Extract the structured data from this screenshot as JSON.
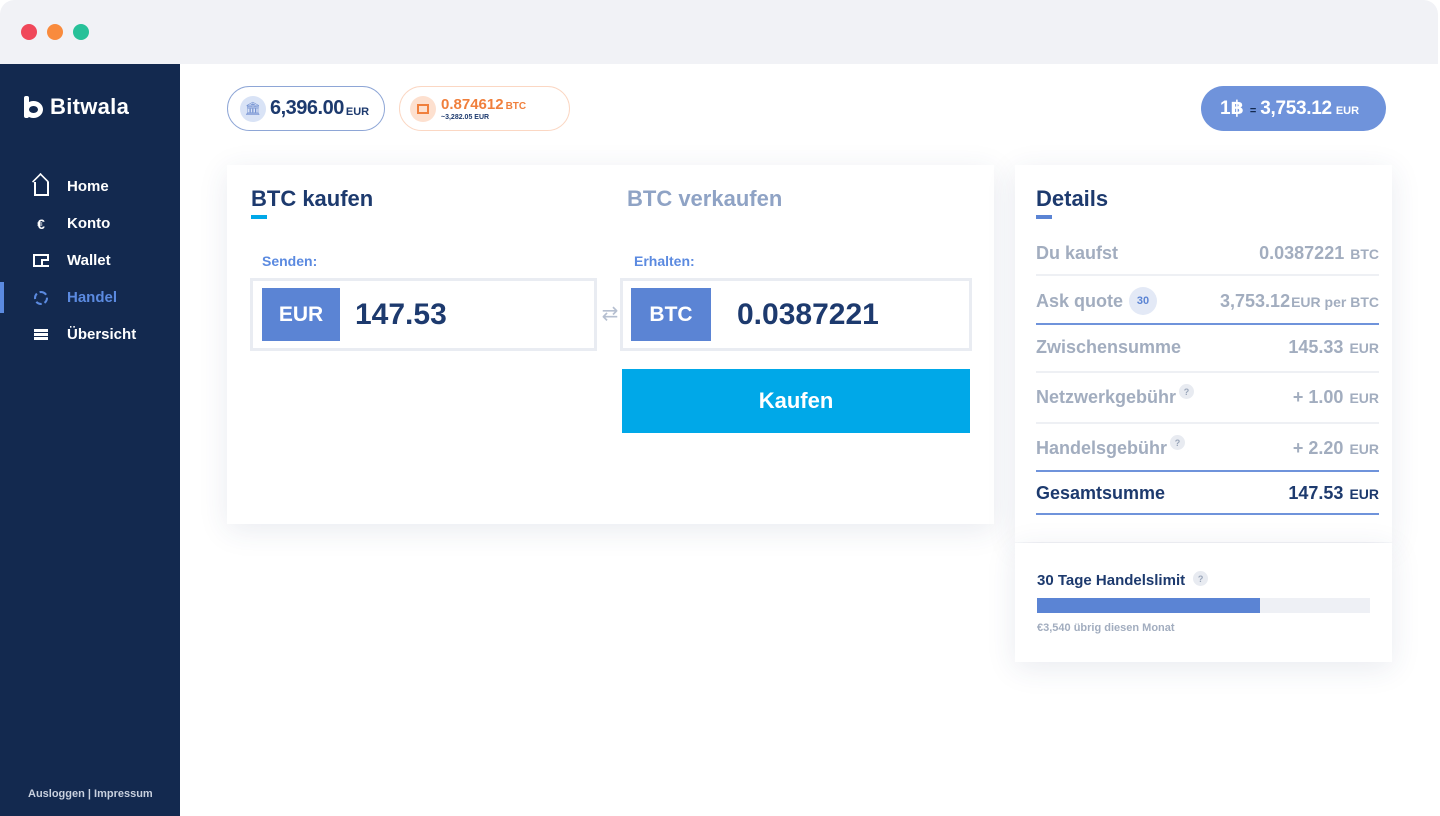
{
  "brand": {
    "name": "Bitwala"
  },
  "sidebar": {
    "items": [
      {
        "label": "Home",
        "icon": "home-icon"
      },
      {
        "label": "Konto",
        "icon": "euro-icon",
        "glyph": "€"
      },
      {
        "label": "Wallet",
        "icon": "wallet-icon"
      },
      {
        "label": "Handel",
        "icon": "refresh-icon",
        "active": true
      },
      {
        "label": "Übersicht",
        "icon": "list-icon"
      }
    ],
    "footer": "Ausloggen | Impressum"
  },
  "balances": {
    "eur": {
      "amount": "6,396.00",
      "currency": "EUR",
      "icon": "bank-icon"
    },
    "btc": {
      "amount": "0.874612",
      "currency": "BTC",
      "sub": "~3,282.05 EUR",
      "icon": "wallet-icon"
    },
    "rate": {
      "lhs": "1",
      "lhs_symbol": "฿",
      "eq": "=",
      "value": "3,753.12",
      "currency": "EUR"
    }
  },
  "trade": {
    "tabs": {
      "buy": "BTC kaufen",
      "sell": "BTC verkaufen"
    },
    "send": {
      "label": "Senden:",
      "currency": "EUR",
      "value": "147.53"
    },
    "receive": {
      "label": "Erhalten:",
      "currency": "BTC",
      "value": "0.0387221"
    },
    "swap_glyph": "⇄",
    "button": "Kaufen"
  },
  "details": {
    "title": "Details",
    "rows": [
      {
        "label": "Du kaufst",
        "value": "0.0387221",
        "currency": "BTC"
      },
      {
        "label": "Ask quote",
        "badge": "30",
        "value": "3,753.12",
        "currency": "EUR per BTC"
      },
      {
        "label": "Zwischensumme",
        "value": "145.33",
        "currency": "EUR"
      },
      {
        "label": "Netzwerkgebühr",
        "help": "?",
        "value": "+ 1.00",
        "currency": "EUR"
      },
      {
        "label": "Handelsgebühr",
        "help": "?",
        "value": "+ 2.20",
        "currency": "EUR"
      },
      {
        "label": "Gesamtsumme",
        "value": "147.53",
        "currency": "EUR"
      }
    ]
  },
  "limit": {
    "title": "30 Tage Handelslimit",
    "help": "?",
    "used_fraction": 0.67,
    "note": "€3,540 übrig diesen Monat"
  },
  "colors": {
    "sidebar": "#13294f",
    "accent_blue": "#5b84d4",
    "cta": "#00a8e8",
    "btc_orange": "#f07f3c",
    "text_dark": "#1d3a6e"
  }
}
